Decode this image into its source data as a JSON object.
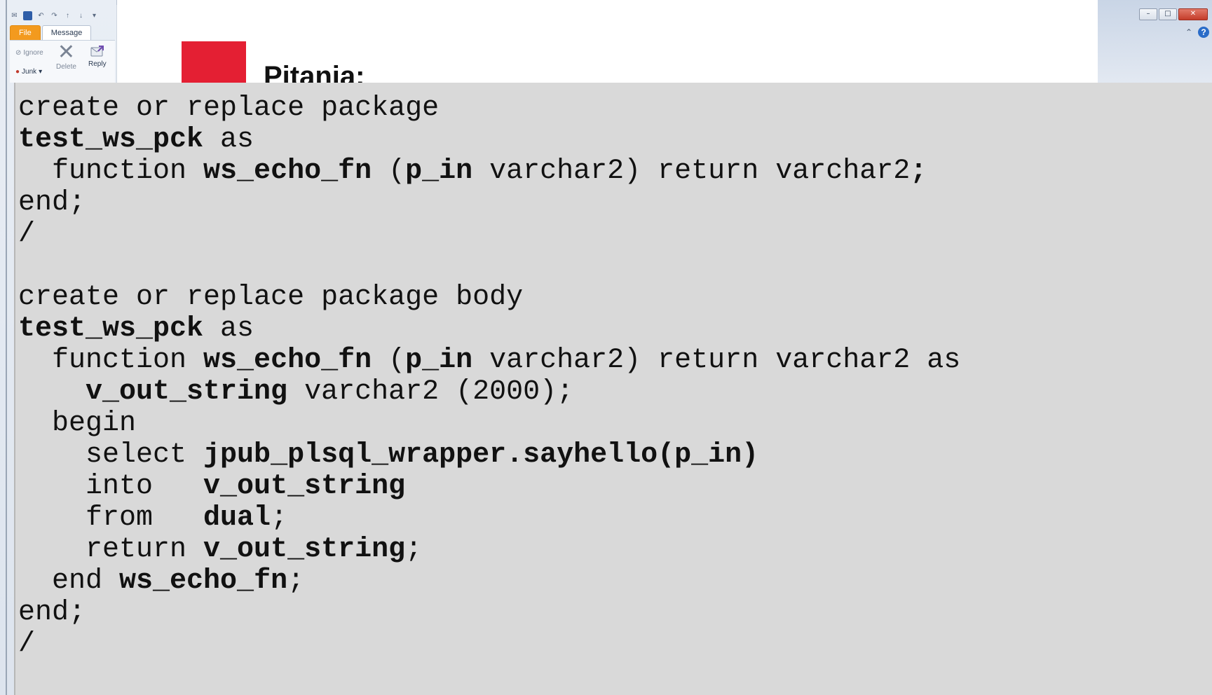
{
  "quick_access": {
    "icons": [
      "mail-icon",
      "save-icon",
      "undo-icon",
      "redo-icon",
      "up-icon",
      "down-icon",
      "customize-icon"
    ]
  },
  "ribbon": {
    "tabs": [
      "File",
      "Message"
    ],
    "ignore_label": "Ignore",
    "junk_label": "Junk",
    "delete_label": "Delete",
    "reply_label": "Reply"
  },
  "message": {
    "heading": "Pitanja:"
  },
  "window": {
    "minimize": "–",
    "maximize": "□",
    "close": "✕",
    "collapse": "⌃",
    "help": "?"
  },
  "code": {
    "lines": [
      [
        {
          "t": "create or replace package",
          "b": false
        }
      ],
      [
        {
          "t": "test_ws_pck",
          "b": true
        },
        {
          "t": " as",
          "b": false
        }
      ],
      [
        {
          "t": "  function ",
          "b": false
        },
        {
          "t": "ws_echo_fn",
          "b": true
        },
        {
          "t": " (",
          "b": false
        },
        {
          "t": "p_in",
          "b": true
        },
        {
          "t": " varchar2) return varchar2",
          "b": false
        },
        {
          "t": ";",
          "b": true
        }
      ],
      [
        {
          "t": "end;",
          "b": false
        }
      ],
      [
        {
          "t": "/",
          "b": false
        }
      ],
      [
        {
          "t": "",
          "b": false
        }
      ],
      [
        {
          "t": "create or replace package body",
          "b": false
        }
      ],
      [
        {
          "t": "test_ws_pck",
          "b": true
        },
        {
          "t": " as",
          "b": false
        }
      ],
      [
        {
          "t": "  function ",
          "b": false
        },
        {
          "t": "ws_echo_fn",
          "b": true
        },
        {
          "t": " (",
          "b": false
        },
        {
          "t": "p_in",
          "b": true
        },
        {
          "t": " varchar2) return varchar2 as",
          "b": false
        }
      ],
      [
        {
          "t": "    ",
          "b": false
        },
        {
          "t": "v_out_string",
          "b": true
        },
        {
          "t": " varchar2 (2000);",
          "b": false
        }
      ],
      [
        {
          "t": "  begin",
          "b": false
        }
      ],
      [
        {
          "t": "    select ",
          "b": false
        },
        {
          "t": "jpub_plsql_wrapper.sayhello(p_in)",
          "b": true
        }
      ],
      [
        {
          "t": "    into   ",
          "b": false
        },
        {
          "t": "v_out_string",
          "b": true
        }
      ],
      [
        {
          "t": "    from   ",
          "b": false
        },
        {
          "t": "dual",
          "b": true
        },
        {
          "t": ";",
          "b": false
        }
      ],
      [
        {
          "t": "    return ",
          "b": false
        },
        {
          "t": "v_out_string",
          "b": true
        },
        {
          "t": ";",
          "b": false
        }
      ],
      [
        {
          "t": "  end ",
          "b": false
        },
        {
          "t": "ws_echo_fn",
          "b": true
        },
        {
          "t": ";",
          "b": false
        }
      ],
      [
        {
          "t": "end;",
          "b": false
        }
      ],
      [
        {
          "t": "/",
          "b": false
        }
      ]
    ]
  }
}
